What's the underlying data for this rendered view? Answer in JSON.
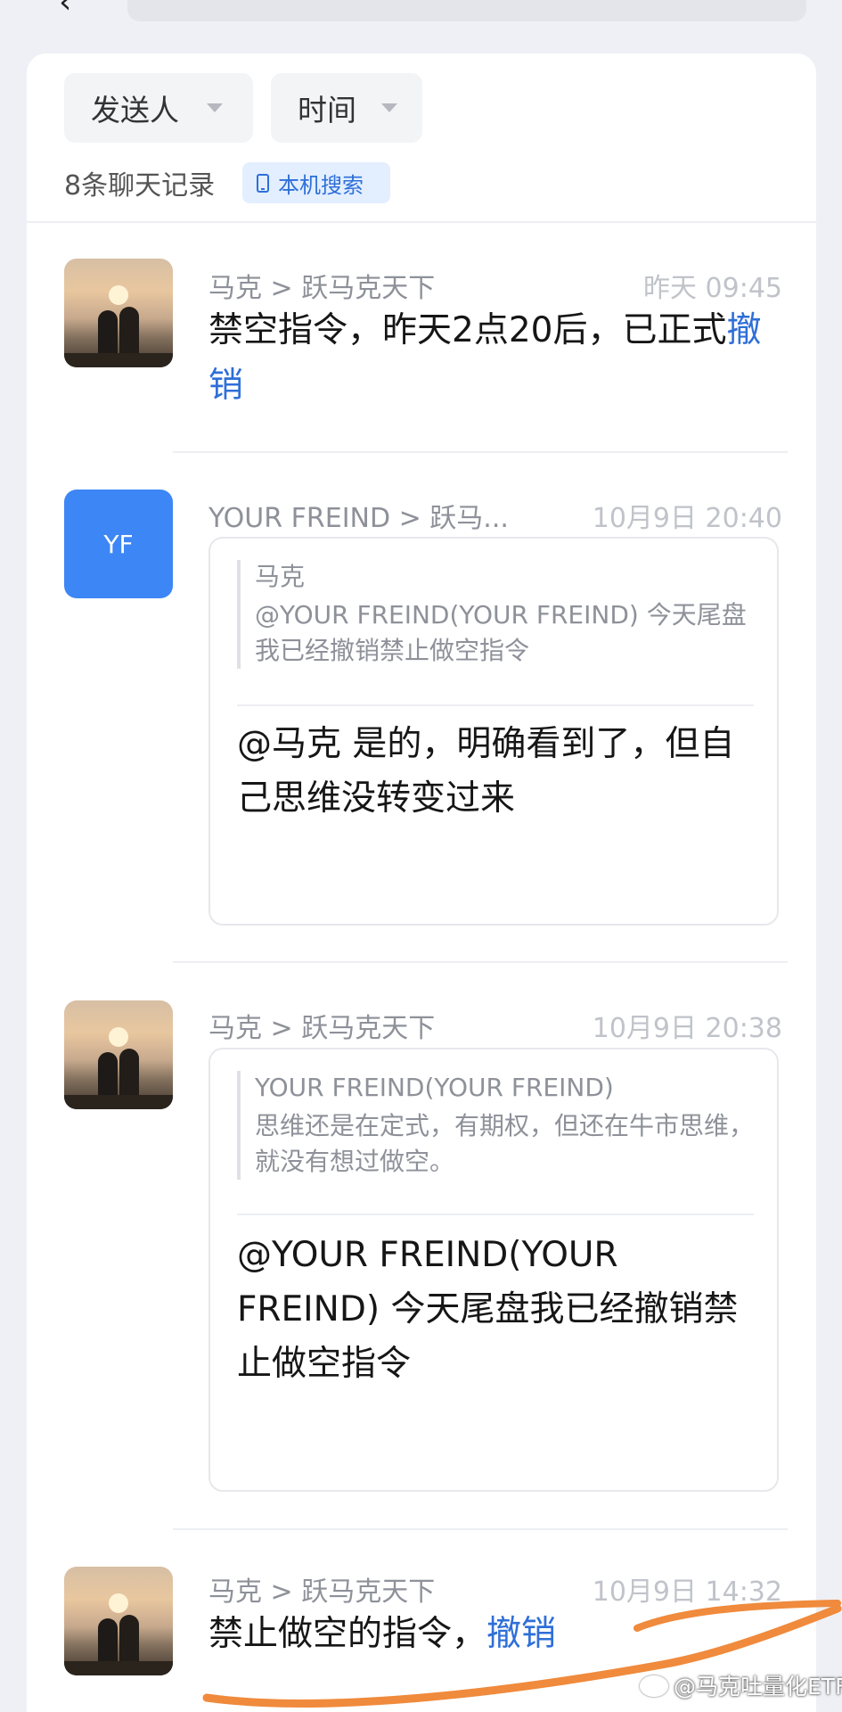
{
  "filters": {
    "sender": "发送人",
    "time": "时间"
  },
  "record_count": "8条聊天记录",
  "local_search": "本机搜索",
  "messages": [
    {
      "sender": "马克 > 跃马克天下",
      "time": "昨天 09:45",
      "text": "禁空指令，昨天2点20后，已正式",
      "link": "撤销"
    },
    {
      "avatar_initials": "YF",
      "sender": "YOUR FREIND > 跃马...",
      "time": "10月9日 20:40",
      "quote_author": "马克",
      "quote_text": "@YOUR FREIND(YOUR FREIND) 今天尾盘我已经撤销禁止做空指令",
      "reply": "@马克 是的，明确看到了，但自己思维没转变过来"
    },
    {
      "sender": "马克 > 跃马克天下",
      "time": "10月9日 20:38",
      "quote_author": "YOUR FREIND(YOUR FREIND)",
      "quote_text": "思维还是在定式，有期权，但还在牛市思维，就没有想过做空。",
      "reply": "@YOUR FREIND(YOUR FREIND) 今天尾盘我已经撤销禁止做空指令"
    },
    {
      "sender": "马克 > 跃马克天下",
      "time": "10月9日 14:32",
      "text": "禁止做空的指令，",
      "link": "撤销"
    }
  ],
  "watermark": "@马克吐量化ETF",
  "colors": {
    "link": "#2f6fd8",
    "avatar_blue": "#3d86f5",
    "annotation": "#f08a3c"
  },
  "icons": [
    "phone-icon",
    "caret-down-icon",
    "weibo-icon"
  ]
}
